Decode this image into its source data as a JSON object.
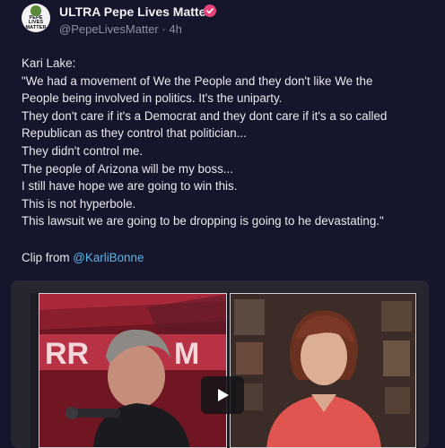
{
  "post": {
    "display_name": "ULTRA Pepe Lives Matter",
    "handle": "@PepeLivesMatter",
    "separator": "·",
    "time_ago": "4h",
    "avatar_text": [
      "PEPE",
      "LIVES",
      "MATTER"
    ],
    "verified_color": "#e5447a",
    "lines": [
      "Kari Lake:",
      "\"We had a movement of We the People and they don't like We the",
      "People being involved in politics. It's the uniparty.",
      "They don't care if it's a Democrat and they dont care if it's a so called",
      "Republican as they control that politician...",
      "They didn't control me.",
      "The people of Arizona will be my boss...",
      "I still have hope we are going to win this.",
      "This is not hyperbole.",
      "This lawsuit we are going to be dropping is going to he devastating.\""
    ],
    "clip_prefix": "Clip from ",
    "clip_link": "@KarliBonne",
    "link_color": "#5ab4e8"
  },
  "video": {
    "banner_text": "RR",
    "banner_letter": "M",
    "play_icon": "play-icon"
  }
}
